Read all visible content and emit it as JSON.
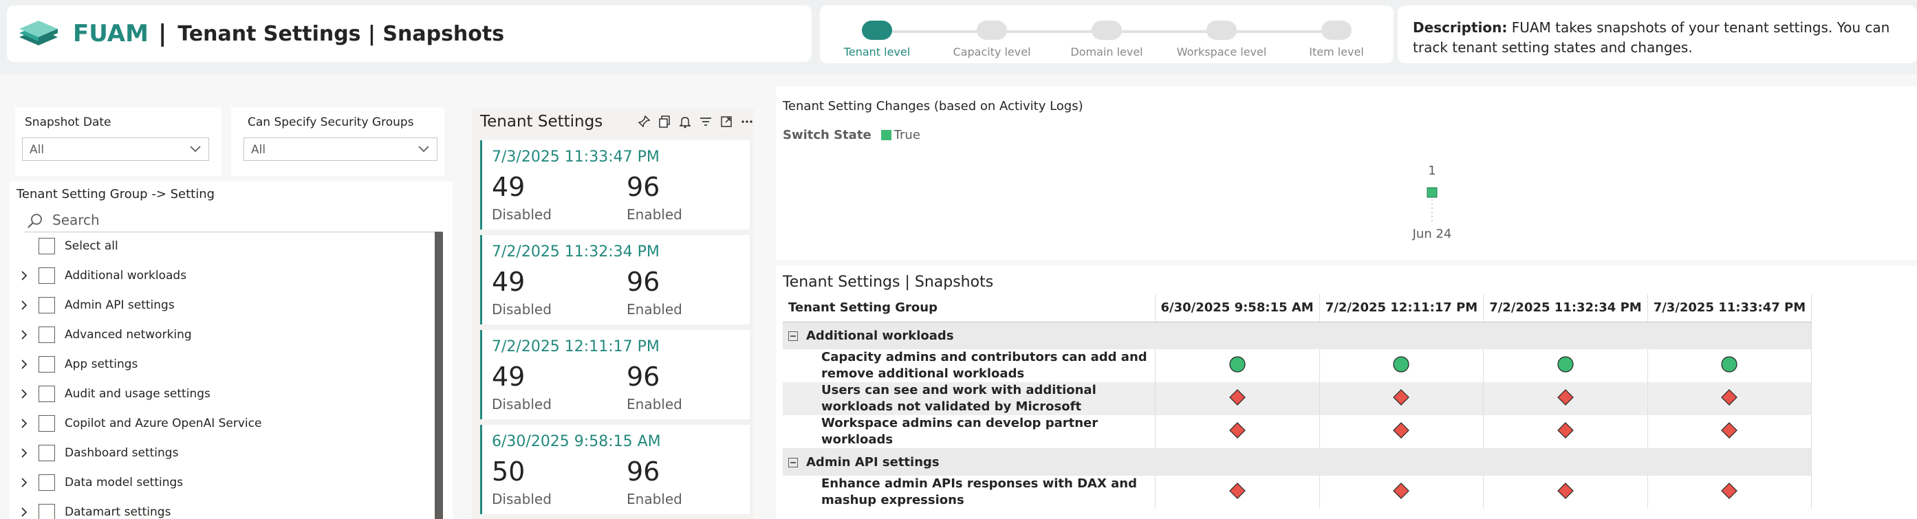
{
  "header": {
    "brand": "FUAM",
    "separator": "|",
    "title": "Tenant Settings | Snapshots"
  },
  "steps": [
    {
      "label": "Tenant level",
      "active": true
    },
    {
      "label": "Capacity level",
      "active": false
    },
    {
      "label": "Domain level",
      "active": false
    },
    {
      "label": "Workspace level",
      "active": false
    },
    {
      "label": "Item level",
      "active": false
    }
  ],
  "description": {
    "label": "Description:",
    "text": " FUAM takes snapshots of your tenant settings. You can track tenant setting states and changes."
  },
  "slicers": {
    "snapshot_date": {
      "label": "Snapshot Date",
      "value": "All"
    },
    "security_groups": {
      "label": "Can Specify Security Groups",
      "value": "All"
    }
  },
  "tree": {
    "header": "Tenant Setting Group -> Setting",
    "search_placeholder": "Search",
    "select_all": "Select all",
    "items": [
      "Additional workloads",
      "Admin API settings",
      "Advanced networking",
      "App settings",
      "Audit and usage settings",
      "Copilot and Azure OpenAI Service",
      "Dashboard settings",
      "Data model settings",
      "Datamart settings"
    ]
  },
  "cardlist": {
    "title": "Tenant Settings",
    "cards": [
      {
        "date": "7/3/2025 11:33:47 PM",
        "disabled": "49",
        "enabled": "96",
        "disabled_label": "Disabled",
        "enabled_label": "Enabled"
      },
      {
        "date": "7/2/2025 11:32:34 PM",
        "disabled": "49",
        "enabled": "96",
        "disabled_label": "Disabled",
        "enabled_label": "Enabled"
      },
      {
        "date": "7/2/2025 12:11:17 PM",
        "disabled": "49",
        "enabled": "96",
        "disabled_label": "Disabled",
        "enabled_label": "Enabled"
      },
      {
        "date": "6/30/2025 9:58:15 AM",
        "disabled": "50",
        "enabled": "96",
        "disabled_label": "Disabled",
        "enabled_label": "Enabled"
      }
    ]
  },
  "chart_data": {
    "type": "scatter",
    "title": "Tenant Setting Changes (based on Activity Logs)",
    "legend_title": "Switch State",
    "series": [
      {
        "name": "True",
        "color": "#3dbb74",
        "points": [
          {
            "x": "Jun 24",
            "y": 1,
            "label": "1"
          }
        ]
      }
    ],
    "categories": [
      "Jun 24"
    ],
    "legend_position": "top-left",
    "grid": false
  },
  "matrix": {
    "title": "Tenant Settings | Snapshots",
    "row_header": "Tenant Setting Group",
    "columns": [
      "6/30/2025 9:58:15 AM",
      "7/2/2025 12:11:17 PM",
      "7/2/2025 11:32:34 PM",
      "7/3/2025 11:33:47 PM"
    ],
    "groups": [
      {
        "name": "Additional workloads",
        "rows": [
          {
            "name": "Capacity admins and contributors can add and remove additional workloads",
            "states": [
              "enabled",
              "enabled",
              "enabled",
              "enabled"
            ]
          },
          {
            "name": "Users can see and work with additional workloads not validated by Microsoft",
            "states": [
              "disabled",
              "disabled",
              "disabled",
              "disabled"
            ]
          },
          {
            "name": "Workspace admins can develop partner workloads",
            "states": [
              "disabled",
              "disabled",
              "disabled",
              "disabled"
            ]
          }
        ]
      },
      {
        "name": "Admin API settings",
        "rows": [
          {
            "name": "Enhance admin APIs responses with DAX and mashup expressions",
            "states": [
              "disabled",
              "disabled",
              "disabled",
              "disabled"
            ]
          }
        ]
      }
    ],
    "colors": {
      "enabled": "#3dbb74",
      "disabled": "#e8534a"
    }
  }
}
